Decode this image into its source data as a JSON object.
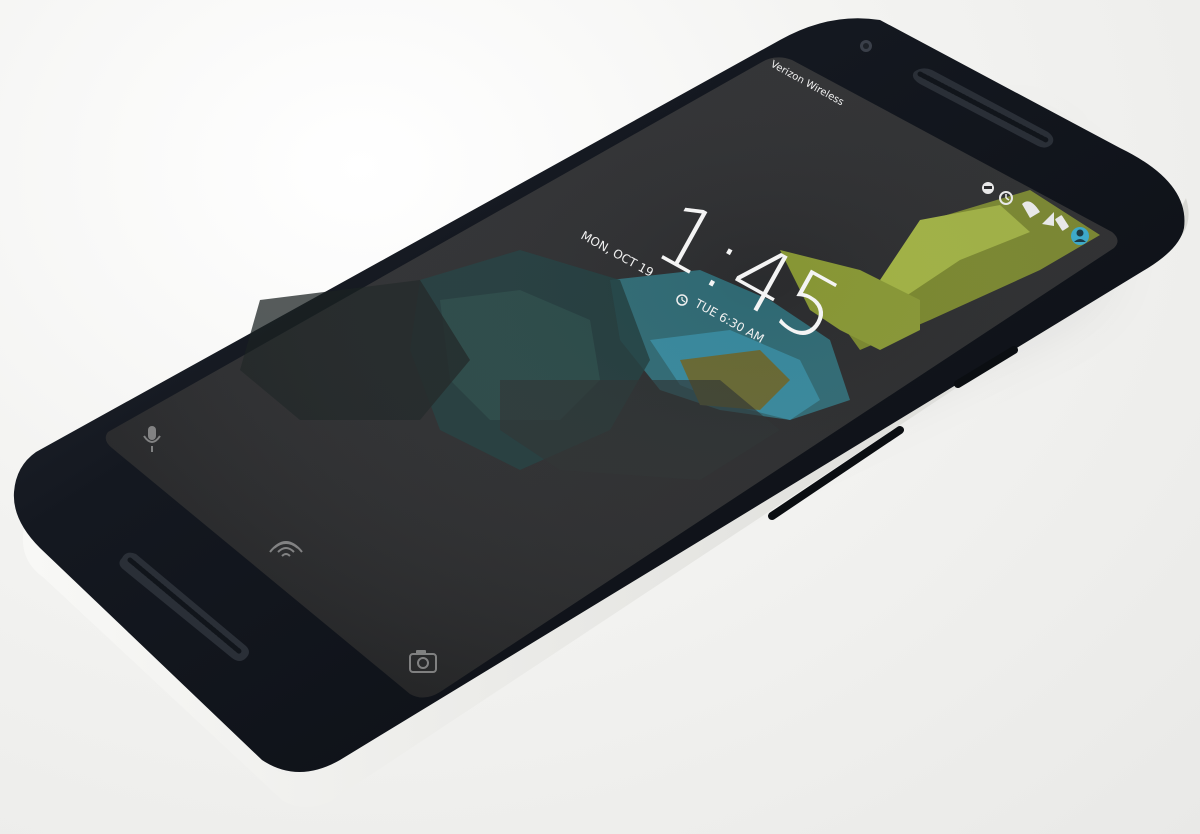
{
  "lockscreen": {
    "carrier": "Verizon Wireless",
    "time": "1:45",
    "date_left": "MON, OCT 19",
    "alarm": "TUE 6:30 AM"
  },
  "status_bar": {
    "icons": [
      "do-not-disturb-icon",
      "alarm-clock-icon",
      "wifi-icon",
      "cellular-signal-icon",
      "battery-icon",
      "avatar-icon"
    ]
  },
  "bottom_icons": [
    "microphone-icon",
    "fingerprint-icon",
    "camera-icon"
  ],
  "colors": {
    "background": "#f1f1ef",
    "phone_body": "#141820",
    "screen": "#2a2b2d",
    "accent_green": "#9fb03a",
    "accent_teal": "#3ea9c9"
  }
}
